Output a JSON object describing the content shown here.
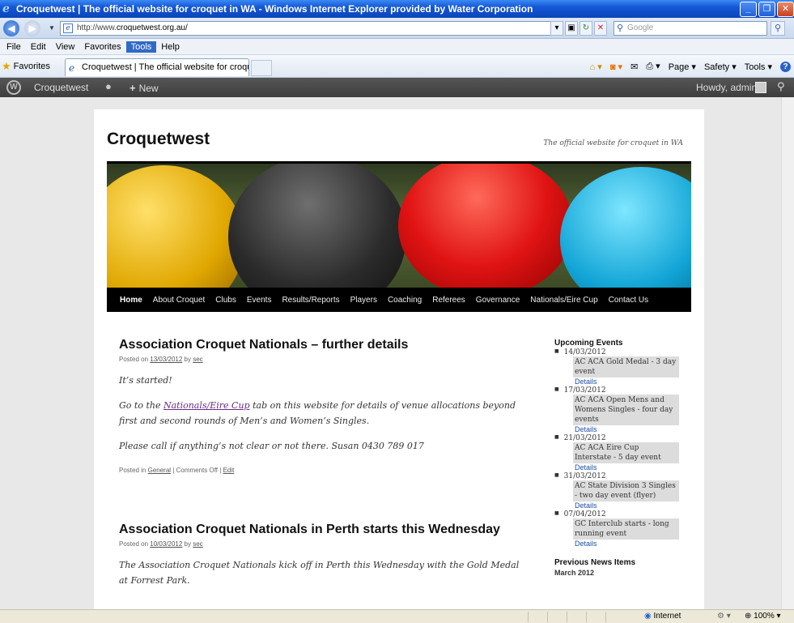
{
  "window": {
    "title": "Croquetwest | The official website for croquet in WA - Windows Internet Explorer provided by Water Corporation",
    "minimize": "_",
    "maximize": "❐",
    "close": "✕"
  },
  "address_bar": {
    "url_prefix": "http://www.",
    "url_domain": "croquetwest.org.au/",
    "search_placeholder": "Google"
  },
  "menu": [
    "File",
    "Edit",
    "View",
    "Favorites",
    "Tools",
    "Help"
  ],
  "menu_active": "Tools",
  "favorites_bar": {
    "favorites_label": "Favorites",
    "tab_title": "Croquetwest | The official website for croquet in WA",
    "page_label": "Page ▾",
    "safety_label": "Safety ▾",
    "tools_label": "Tools ▾"
  },
  "admin_bar": {
    "site_name": "Croquetwest",
    "new_label": "New",
    "howdy": "Howdy, admin"
  },
  "site": {
    "title": "Croquetwest",
    "description": "The official website for croquet in WA",
    "nav": [
      "Home",
      "About Croquet",
      "Clubs",
      "Events",
      "Results/Reports",
      "Players",
      "Coaching",
      "Referees",
      "Governance",
      "Nationals/Eire Cup",
      "Contact Us"
    ]
  },
  "posts": [
    {
      "title": "Association Croquet Nationals – further details",
      "posted_on": "Posted on",
      "date": "13/03/2012",
      "by": "by",
      "author": "sec",
      "p1": "It’s started!",
      "p2_before": "Go to the ",
      "p2_link": "Nationals/Eire Cup",
      "p2_after": " tab on this website for details of venue allocations beyond first and second rounds of Men’s and Women’s Singles.",
      "p3": "Please call if anything’s not clear or not there.  Susan 0430 789 017",
      "posted_in": "Posted in",
      "category": "General",
      "comments": "| Comments Off |",
      "edit": "Edit"
    },
    {
      "title": "Association Croquet Nationals in Perth starts this Wednesday",
      "posted_on": "Posted on",
      "date": "10/03/2012",
      "by": "by",
      "author": "sec",
      "p1": "The Association Croquet Nationals kick off in Perth this Wednesday with the Gold Medal at Forrest Park."
    }
  ],
  "sidebar": {
    "upcoming_title": "Upcoming Events",
    "events": [
      {
        "date": "14/03/2012",
        "desc": "AC ACA Gold Medal - 3 day event",
        "link": "Details"
      },
      {
        "date": "17/03/2012",
        "desc": "AC ACA Open Mens and Womens Singles - four day events",
        "link": "Details"
      },
      {
        "date": "21/03/2012",
        "desc": "AC ACA Eire Cup Interstate - 5 day event",
        "link": "Details"
      },
      {
        "date": "31/03/2012",
        "desc": "AC State Division 3 Singles - two day event (flyer)",
        "link": "Details"
      },
      {
        "date": "07/04/2012",
        "desc": "GC Interclub starts - long running event",
        "link": "Details"
      }
    ],
    "previous_title": "Previous News Items",
    "previous_month": "March 2012"
  },
  "status_bar": {
    "zone": "Internet",
    "zoom": "100%"
  }
}
